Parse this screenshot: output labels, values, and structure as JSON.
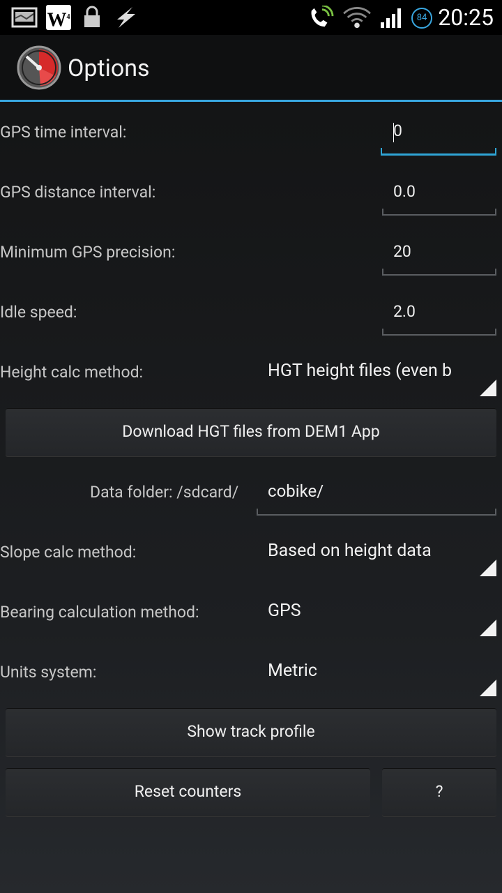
{
  "status_bar": {
    "time": "20:25",
    "battery": "84",
    "icons": [
      "notification-image-icon",
      "w4-widget-icon",
      "lock-icon",
      "flash-icon",
      "phone-signal-icon",
      "wifi-icon",
      "cell-signal-icon",
      "battery-icon"
    ]
  },
  "action_bar": {
    "title": "Options",
    "icon": "cobike-gauge-icon"
  },
  "fields": {
    "gps_time_interval": {
      "label": "GPS time interval:",
      "value": "0"
    },
    "gps_distance_interval": {
      "label": "GPS distance interval:",
      "value": "0.0"
    },
    "min_gps_precision": {
      "label": "Minimum GPS precision:",
      "value": "20"
    },
    "idle_speed": {
      "label": "Idle speed:",
      "value": "2.0"
    },
    "height_calc": {
      "label": "Height calc method:",
      "value": "HGT height files (even b"
    },
    "data_folder": {
      "label": "Data folder:  /sdcard/",
      "value": "cobike/"
    },
    "slope_calc": {
      "label": "Slope calc method:",
      "value": "Based on height data"
    },
    "bearing_calc": {
      "label": "Bearing calculation method:",
      "value": "GPS"
    },
    "units_system": {
      "label": "Units system:",
      "value": "Metric"
    }
  },
  "buttons": {
    "download_hgt": "Download HGT files from DEM1 App",
    "show_track_profile": "Show track profile",
    "reset_counters": "Reset counters",
    "help": "?"
  },
  "colors": {
    "accent": "#39a7e0",
    "background": "#1d1f22"
  }
}
